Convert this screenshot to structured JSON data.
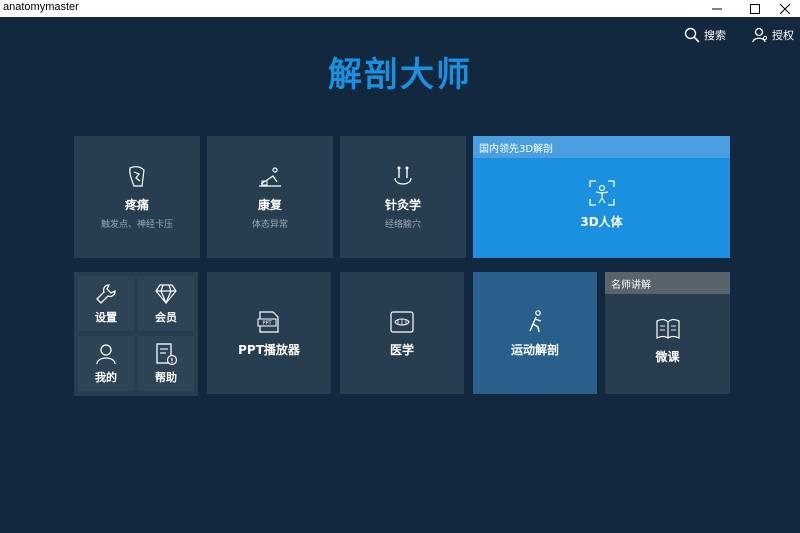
{
  "window": {
    "title": "anatomymaster"
  },
  "topbar": {
    "search_label": "搜索",
    "auth_label": "授权"
  },
  "logo": {
    "text": "解剖大师"
  },
  "tiles": {
    "pain": {
      "label": "疼痛",
      "sub": "触发点、神经卡压"
    },
    "rehab": {
      "label": "康复",
      "sub": "体态异常"
    },
    "acupuncture": {
      "label": "针灸学",
      "sub": "经络腧穴"
    },
    "anatomy3d": {
      "banner": "国内领先3D解剖",
      "label": "3D人体"
    },
    "ppt": {
      "label": "PPT播放器"
    },
    "medicine": {
      "label": "医学"
    },
    "sports": {
      "label": "运动解剖"
    },
    "microcourse": {
      "banner": "名师讲解",
      "label": "微课"
    }
  },
  "small_tiles": {
    "settings": "设置",
    "member": "会员",
    "mine": "我的",
    "help": "帮助"
  },
  "colors": {
    "background": "#11283e",
    "tile": "#273d50",
    "accent_blue": "#1b8fe0",
    "sports_tile": "#2a5f8c",
    "banner_gray": "#59636c"
  }
}
